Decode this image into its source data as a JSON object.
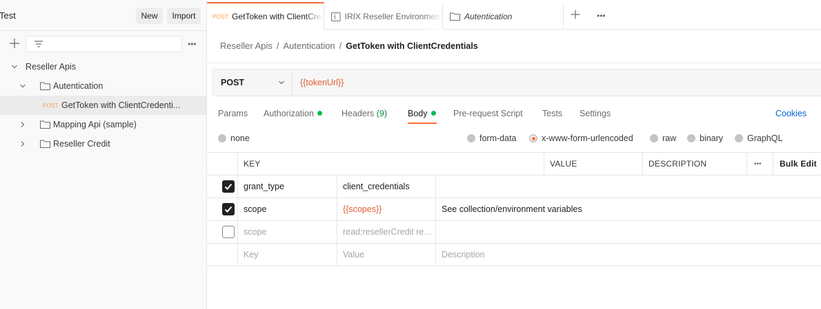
{
  "sidebar": {
    "workspace": "Test",
    "new_label": "New",
    "import_label": "Import",
    "tree": [
      {
        "label": "Reseller Apis",
        "type": "collection",
        "expanded": true
      },
      {
        "label": "Autentication",
        "type": "folder",
        "expanded": true
      },
      {
        "method": "POST",
        "label": "GetToken with ClientCredenti...",
        "type": "request",
        "active": true
      },
      {
        "label": "Mapping Api (sample)",
        "type": "folder",
        "expanded": false
      },
      {
        "label": "Reseller Credit",
        "type": "folder",
        "expanded": false
      }
    ]
  },
  "tabs": [
    {
      "method": "POST",
      "label": "GetToken with ClientCre",
      "active": true
    },
    {
      "label": "IRIX Reseller Environment",
      "icon": "environment-icon"
    },
    {
      "label": "Autentication",
      "icon": "folder-icon"
    }
  ],
  "breadcrumb": {
    "items": [
      "Reseller Apis",
      "Autentication"
    ],
    "separator": "/",
    "current": "GetToken with ClientCredentials"
  },
  "request": {
    "method": "POST",
    "url": "{{tokenUrl}}"
  },
  "subtabs": [
    {
      "label": "Params"
    },
    {
      "label": "Authorization",
      "dot": true
    },
    {
      "label": "Headers",
      "count": "(9)"
    },
    {
      "label": "Body",
      "dot": true,
      "active": true
    },
    {
      "label": "Pre-request Script"
    },
    {
      "label": "Tests"
    },
    {
      "label": "Settings"
    }
  ],
  "cookies_label": "Cookies",
  "body_modes": [
    "none",
    "form-data",
    "x-www-form-urlencoded",
    "raw",
    "binary",
    "GraphQL"
  ],
  "body_mode_selected": "x-www-form-urlencoded",
  "table": {
    "headers": {
      "key": "KEY",
      "value": "VALUE",
      "description": "DESCRIPTION",
      "bulk_edit": "Bulk Edit"
    },
    "rows": [
      {
        "checked": true,
        "key": "grant_type",
        "value": "client_credentials",
        "description": ""
      },
      {
        "checked": true,
        "key": "scope",
        "value": "{{scopes}}",
        "description": "See collection/environment variables"
      },
      {
        "checked": false,
        "key": "scope",
        "value": "read:resellerCredit re...",
        "description": ""
      }
    ],
    "placeholder": {
      "key": "Key",
      "value": "Value",
      "description": "Description"
    }
  },
  "colors": {
    "accent": "#ff6c37",
    "method_post": "#ff9f40",
    "variable": "#e05e36",
    "link": "#0265d2",
    "indicator_green": "#0cbb52"
  }
}
